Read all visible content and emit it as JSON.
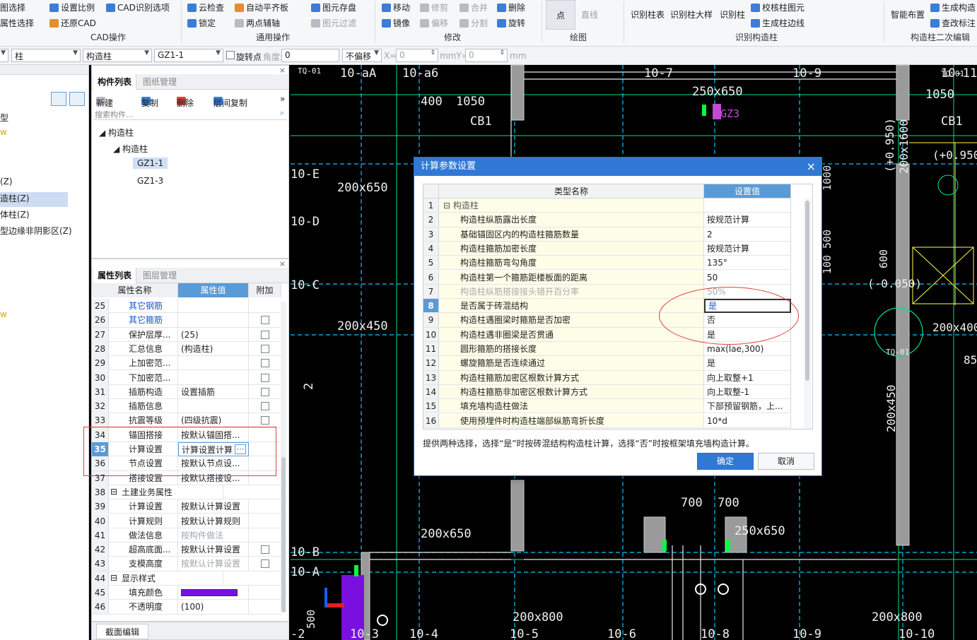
{
  "ribbon": {
    "row1": [
      "图选择",
      "设置比例",
      "CAD识别选项",
      "云检查",
      "自动平齐板",
      "图元存盘",
      "移动",
      "修剪",
      "合并",
      "删除",
      "识别柱表",
      "识别柱大样",
      "识别柱",
      "校核柱图元",
      "智能布置",
      "生成构造"
    ],
    "row2": [
      "属性选择",
      "还原CAD",
      "锁定",
      "两点辅轴",
      "图元过滤",
      "镜像",
      "偏移",
      "分割",
      "旋转",
      "生成柱边线",
      "查改标注"
    ],
    "draw_items": [
      "点",
      "直线"
    ],
    "groups": [
      "CAD操作",
      "通用操作",
      "修改",
      "绘图",
      "识别构造柱",
      "构造柱二次编辑"
    ]
  },
  "toolbar": {
    "combo_floor": "柱",
    "combo_type": "构造柱",
    "combo_comp": "GZ1-1",
    "rotate_label": "旋转点",
    "angle_label": "角度:",
    "angle_value": "0",
    "offset": "不偏移",
    "x_label": "X=",
    "x_value": "0",
    "mmy_label": "mmY=",
    "y_value": "0",
    "mm_label": "mm"
  },
  "leftnav": {
    "items": [
      "型",
      "",
      "(Z)",
      "造柱(Z)",
      "体柱(Z)",
      "型边缘非阴影区(Z)"
    ]
  },
  "component_panel": {
    "tabs": [
      "构件列表",
      "图纸管理"
    ],
    "tools": [
      "新建",
      "复制",
      "删除",
      "层间复制"
    ],
    "search_placeholder": "搜索构件...",
    "tree": [
      "构造柱",
      "构造柱",
      "GZ1-1",
      "GZ1-3"
    ]
  },
  "property_panel": {
    "tabs": [
      "属性列表",
      "图层管理"
    ],
    "headers": [
      "属性名称",
      "属性值",
      "附加"
    ],
    "rows": [
      {
        "num": "25",
        "name": "其它钢筋",
        "value": "",
        "check": false
      },
      {
        "num": "26",
        "name": "其它箍筋",
        "value": "",
        "check": true
      },
      {
        "num": "27",
        "name": "保护层厚...",
        "value": "(25)",
        "check": true
      },
      {
        "num": "28",
        "name": "汇总信息",
        "value": "(构造柱)",
        "check": true
      },
      {
        "num": "29",
        "name": "上加密范...",
        "value": "",
        "check": true
      },
      {
        "num": "30",
        "name": "下加密范...",
        "value": "",
        "check": true
      },
      {
        "num": "31",
        "name": "插筋构造",
        "value": "设置插筋",
        "check": true
      },
      {
        "num": "32",
        "name": "插筋信息",
        "value": "",
        "check": true
      },
      {
        "num": "33",
        "name": "抗震等级",
        "value": "(四级抗震)",
        "check": true
      },
      {
        "num": "34",
        "name": "锚固搭接",
        "value": "按默认锚固搭...",
        "check": false
      },
      {
        "num": "35",
        "name": "计算设置",
        "value": "计算设置计算",
        "check": false
      },
      {
        "num": "36",
        "name": "节点设置",
        "value": "按默认节点设...",
        "check": false
      },
      {
        "num": "37",
        "name": "搭接设置",
        "value": "按默认搭接设...",
        "check": false
      },
      {
        "num": "38",
        "name": "土建业务属性",
        "value": "",
        "check": false
      },
      {
        "num": "39",
        "name": "计算设置",
        "value": "按默认计算设置",
        "check": false
      },
      {
        "num": "40",
        "name": "计算规则",
        "value": "按默认计算规则",
        "check": false
      },
      {
        "num": "41",
        "name": "做法信息",
        "value": "按构件做法",
        "check": false
      },
      {
        "num": "42",
        "name": "超高底面...",
        "value": "按默认计算设置",
        "check": true
      },
      {
        "num": "43",
        "name": "支模高度",
        "value": "按默认计算设置",
        "check": true
      },
      {
        "num": "44",
        "name": "显示样式",
        "value": "",
        "check": false
      },
      {
        "num": "45",
        "name": "填充颜色",
        "value": "",
        "check": false
      },
      {
        "num": "46",
        "name": "不透明度",
        "value": "(100)",
        "check": false
      }
    ],
    "fill_color": "#7a10e0",
    "bottom_tab": "截面编辑"
  },
  "cad": {
    "texts": [
      "10-aA",
      "10-a6",
      "10-7",
      "10-9",
      "10-11",
      "400",
      "1050",
      "CB1",
      "250x650",
      "1050",
      "CB1",
      "(+0.950)",
      "10-E",
      "200x650",
      "10-D",
      "(+0.950)",
      "200x1600",
      "10-C",
      "200x450",
      "200x450",
      "2",
      "200x400",
      "(-0.050)",
      "10-B",
      "200x650",
      "700",
      "700",
      "250x650",
      "10-A",
      "200x800",
      "200x800",
      "10-3",
      "10-4",
      "10-5",
      "10-6",
      "10-8",
      "10-9",
      "10-10",
      "-2",
      "500",
      "800",
      "600",
      "1000",
      "500",
      "100",
      "85",
      "TQ-01",
      "TQ-01",
      "TQ-01",
      "GZ3",
      "700",
      "200x1600"
    ]
  },
  "dialog": {
    "title": "计算参数设置",
    "headers": [
      "类型名称",
      "设置值"
    ],
    "rows": [
      {
        "num": "1",
        "name": "构造柱",
        "value": ""
      },
      {
        "num": "2",
        "name": "构造柱纵筋露出长度",
        "value": "按规范计算"
      },
      {
        "num": "3",
        "name": "基础锚固区内的构造柱箍筋数量",
        "value": "2"
      },
      {
        "num": "4",
        "name": "构造柱箍筋加密长度",
        "value": "按规范计算"
      },
      {
        "num": "5",
        "name": "构造柱箍筋弯勾角度",
        "value": "135°"
      },
      {
        "num": "6",
        "name": "构造柱第一个箍筋距楼板面的距离",
        "value": "50"
      },
      {
        "num": "7",
        "name": "构造柱纵筋搭接接头错开百分率",
        "value": "50%"
      },
      {
        "num": "8",
        "name": "是否属于砖混结构",
        "value": "是"
      },
      {
        "num": "9",
        "name": "构造柱遇圈梁时箍筋是否加密",
        "value": "否"
      },
      {
        "num": "10",
        "name": "构造柱遇非圈梁是否贯通",
        "value": "是"
      },
      {
        "num": "11",
        "name": "圆形箍筋的搭接长度",
        "value": "max(lae,300)"
      },
      {
        "num": "12",
        "name": "螺旋箍筋是否连续通过",
        "value": "是"
      },
      {
        "num": "13",
        "name": "构造柱箍筋加密区根数计算方式",
        "value": "向上取整+1"
      },
      {
        "num": "14",
        "name": "构造柱箍筋非加密区根数计算方式",
        "value": "向上取整-1"
      },
      {
        "num": "15",
        "name": "填充墙构造柱做法",
        "value": "下部预留钢筋，上..."
      },
      {
        "num": "16",
        "name": "使用预埋件时构造柱端部纵筋弯折长度",
        "value": "10*d"
      }
    ],
    "hint": "提供两种选择，选择“是”时按砖混结构构造柱计算，选择“否”时按框架填充墙构造计算。",
    "ok": "确定",
    "cancel": "取消"
  }
}
